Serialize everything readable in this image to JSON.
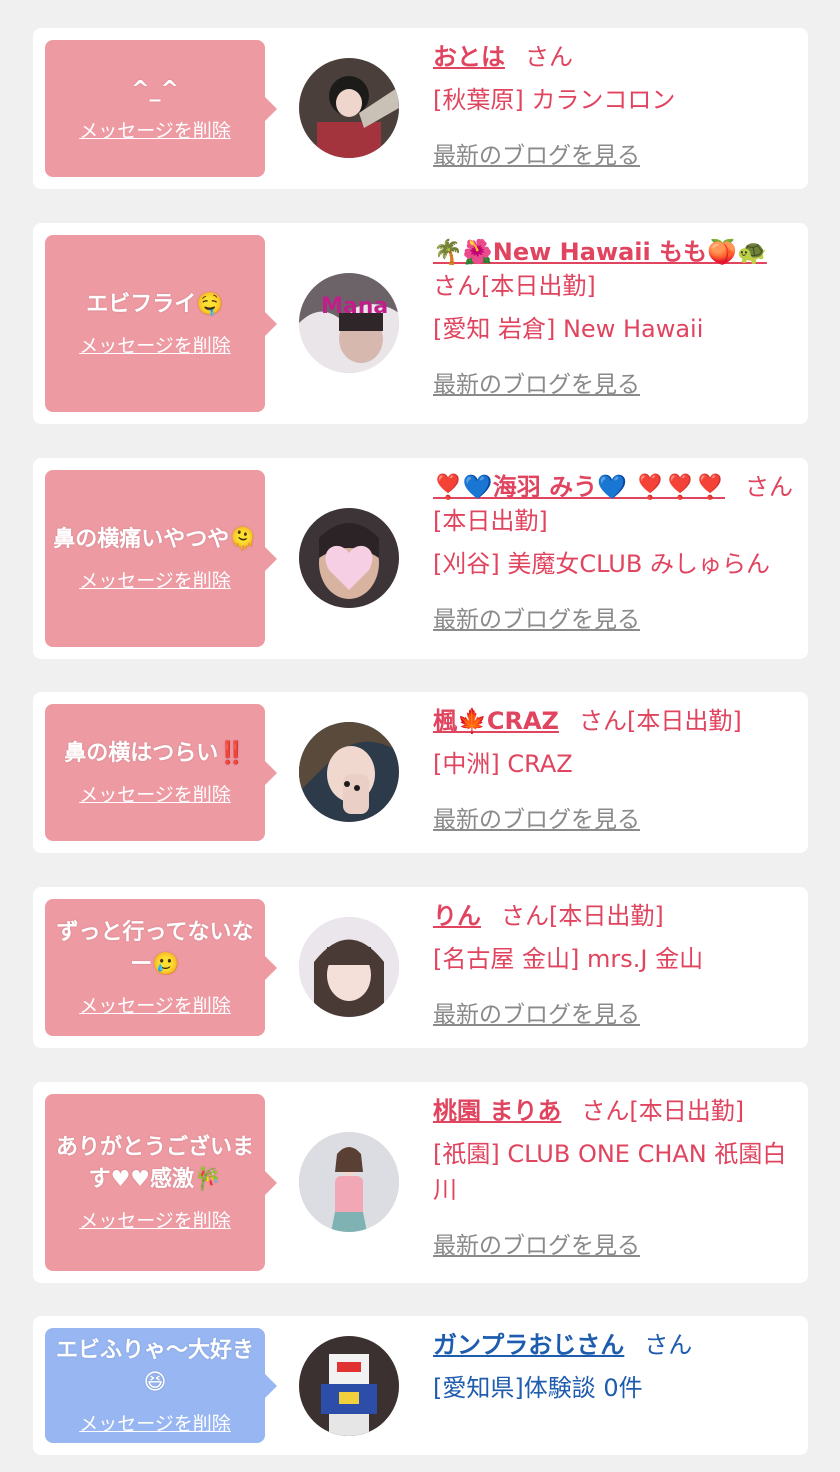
{
  "colors": {
    "page_bg": "#f0f0f0",
    "bubble_pink": "#ee9aa3",
    "bubble_blue": "#97b6f2",
    "name_pink": "#e0445f",
    "name_blue": "#1d5cae",
    "blog_gray": "#8a8a8a"
  },
  "common": {
    "delete_label": "メッセージを削除",
    "blog_label": "最新のブログを見る",
    "san_label": "さん"
  },
  "items": [
    {
      "message": "^_^",
      "name": "おとは",
      "suffix": "",
      "shop": "[秋葉原] カランコロン"
    },
    {
      "message": "エビフライ🤤",
      "name": "🌴🌺New Hawaii もも🍑🐢",
      "suffix": "[本日出勤]",
      "shop": "[愛知 岩倉] New Hawaii"
    },
    {
      "message": "鼻の横痛いやつや🫠",
      "name": "❣️💙海羽 みう💙 ❣️❣️❣️",
      "suffix": "[本日出勤]",
      "shop": "[刈谷] 美魔女CLUB みしゅらん"
    },
    {
      "message": "鼻の横はつらい‼️",
      "name": "楓🍁CRAZ",
      "suffix": "[本日出勤]",
      "shop": "[中洲] CRAZ"
    },
    {
      "message": "ずっと行ってないなー🥲",
      "name": "りん",
      "suffix": "[本日出勤]",
      "shop": "[名古屋 金山] mrs.J 金山"
    },
    {
      "message": "ありがとうございます♥♥感激🎋",
      "name": "桃園 まりあ",
      "suffix": "[本日出勤]",
      "shop": "[祇園] CLUB ONE CHAN 祇園白川"
    },
    {
      "message": "エビふりゃ〜大好き😆",
      "name": "ガンプラおじさん",
      "suffix": "",
      "shop": "[愛知県]体験談 0件"
    }
  ]
}
